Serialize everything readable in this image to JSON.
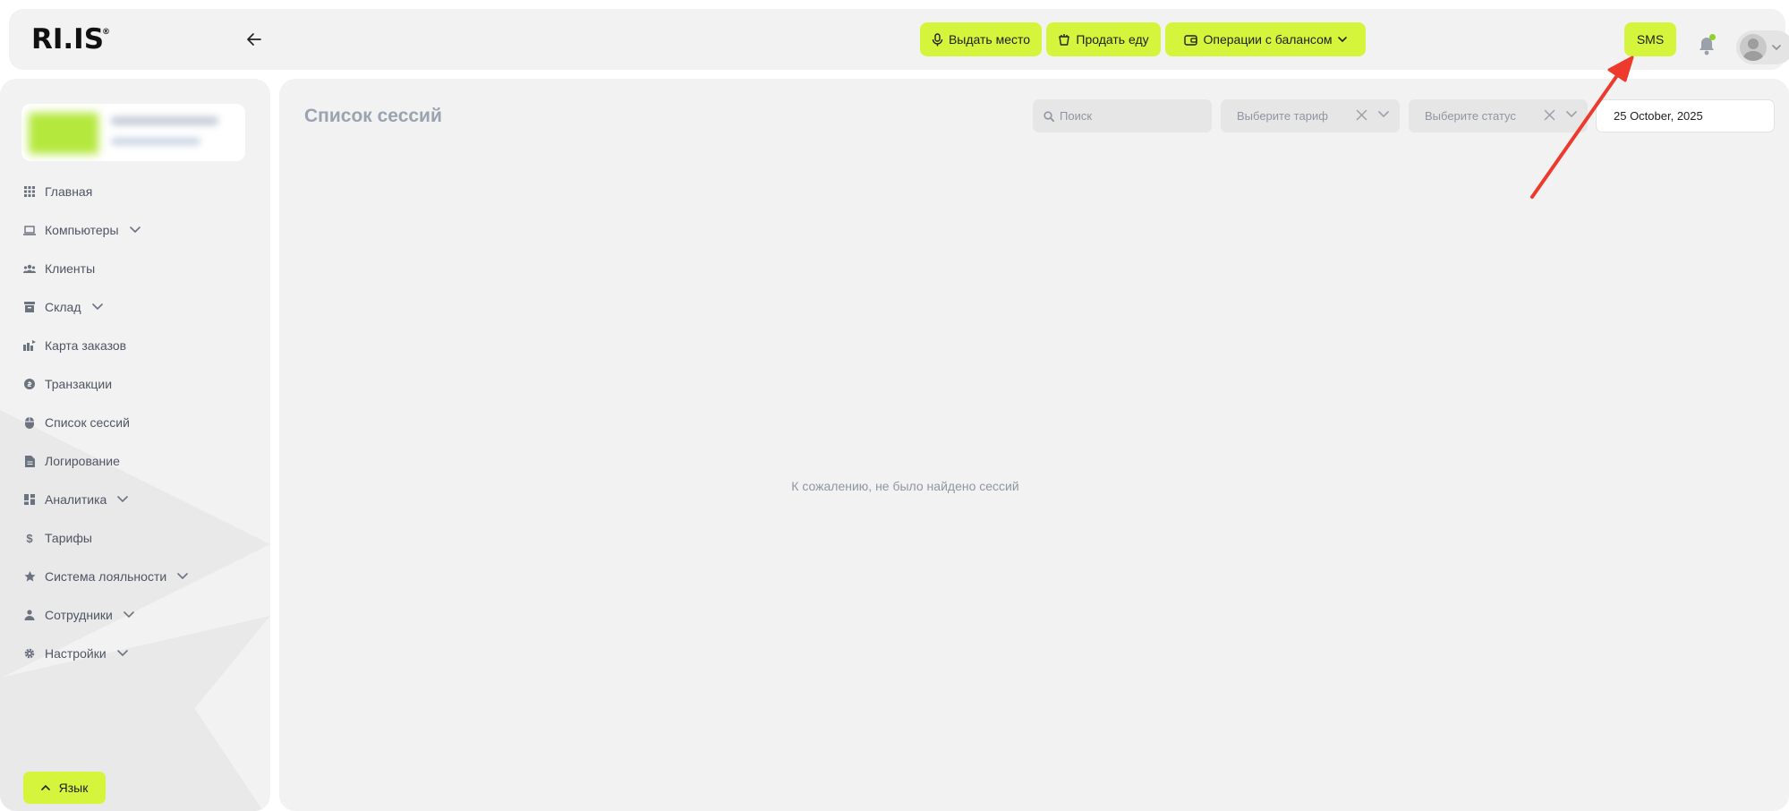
{
  "header": {
    "logo_text": "RI.IS",
    "logo_mark": "®",
    "buttons": {
      "give_seat": "Выдать место",
      "sell_food": "Продать еду",
      "balance_ops": "Операции с балансом",
      "sms": "SMS"
    }
  },
  "sidebar": {
    "items": [
      {
        "label": "Главная",
        "icon": "grid-icon"
      },
      {
        "label": "Компьютеры",
        "icon": "laptop-icon",
        "expandable": true
      },
      {
        "label": "Клиенты",
        "icon": "users-icon"
      },
      {
        "label": "Склад",
        "icon": "archive-icon",
        "expandable": true
      },
      {
        "label": "Карта заказов",
        "icon": "map-icon"
      },
      {
        "label": "Транзакции",
        "icon": "coin-icon"
      },
      {
        "label": "Список сессий",
        "icon": "mouse-icon"
      },
      {
        "label": "Логирование",
        "icon": "file-icon"
      },
      {
        "label": "Аналитика",
        "icon": "dashboard-icon",
        "expandable": true
      },
      {
        "label": "Тарифы",
        "icon": "dollar-icon"
      },
      {
        "label": "Система лояльности",
        "icon": "star-icon",
        "expandable": true
      },
      {
        "label": "Сотрудники",
        "icon": "person-icon",
        "expandable": true
      },
      {
        "label": "Настройки",
        "icon": "gear-icon",
        "expandable": true
      }
    ],
    "language_button": "Язык"
  },
  "main": {
    "title": "Список сессий",
    "search_placeholder": "Поиск",
    "tariff_placeholder": "Выберите тариф",
    "status_placeholder": "Выберите статус",
    "date_value": "25 October, 2025",
    "empty_message": "К сожалению, не было найдено сессий"
  },
  "colors": {
    "accent": "#d4f53c",
    "panel": "#f2f2f2",
    "muted_text": "#8f96a3",
    "annotation": "#ee3a2c"
  }
}
